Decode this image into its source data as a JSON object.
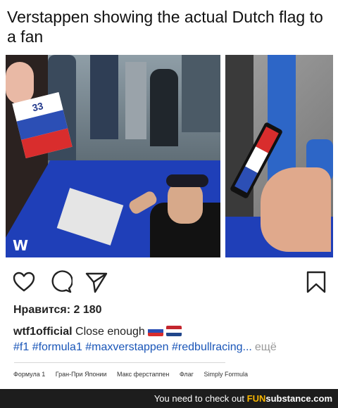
{
  "headline": "Verstappen showing the actual Dutch flag to a fan",
  "photos": {
    "left_sign_number": "33",
    "watermark": "W"
  },
  "actions": {
    "like_icon": "heart-outline-icon",
    "comment_icon": "comment-bubble-icon",
    "share_icon": "send-arrow-icon",
    "save_icon": "bookmark-outline-icon"
  },
  "likes": "Нравится: 2 180",
  "caption": {
    "username": "wtf1official",
    "text": "Close enough",
    "hashtags": "#f1 #formula1 #maxverstappen #redbullracing...",
    "more": "ещё"
  },
  "tags": [
    "Формула 1",
    "Гран-При Японии",
    "Макс ферстаппен",
    "Флаг",
    "Simply Formula"
  ],
  "footer": {
    "prefix": "You need to check out",
    "brand_fun": "FUN",
    "brand_rest": "substance",
    "brand_suffix": ".com"
  },
  "colors": {
    "hashtag": "#1a56b8",
    "footer_bg": "#1d1d1d",
    "brand_accent": "#f7b500"
  }
}
